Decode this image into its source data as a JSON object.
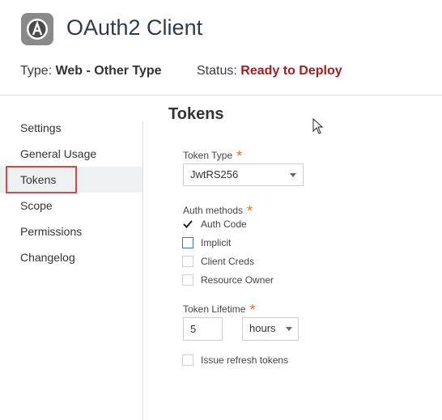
{
  "header": {
    "title": "OAuth2 Client"
  },
  "meta": {
    "type_label": "Type:",
    "type_value": "Web - Other Type",
    "status_label": "Status:",
    "status_value": "Ready to Deploy"
  },
  "sidebar": {
    "items": [
      {
        "label": "Settings"
      },
      {
        "label": "General Usage"
      },
      {
        "label": "Tokens"
      },
      {
        "label": "Scope"
      },
      {
        "label": "Permissions"
      },
      {
        "label": "Changelog"
      }
    ]
  },
  "main": {
    "title": "Tokens",
    "token_type": {
      "label": "Token Type",
      "value": "JwtRS256"
    },
    "auth_methods": {
      "label": "Auth methods",
      "options": [
        {
          "label": "Auth Code",
          "checked": true
        },
        {
          "label": "Implicit",
          "checked": false
        },
        {
          "label": "Client Creds",
          "checked": false
        },
        {
          "label": "Resource Owner",
          "checked": false
        }
      ]
    },
    "token_lifetime": {
      "label": "Token Lifetime",
      "value": "5",
      "unit": "hours"
    },
    "refresh": {
      "label": "Issue refresh tokens",
      "checked": false
    }
  },
  "required_marker": "*",
  "colors": {
    "status": "#a51d1d",
    "required": "#e8712a",
    "active_outline": "#e04545"
  }
}
